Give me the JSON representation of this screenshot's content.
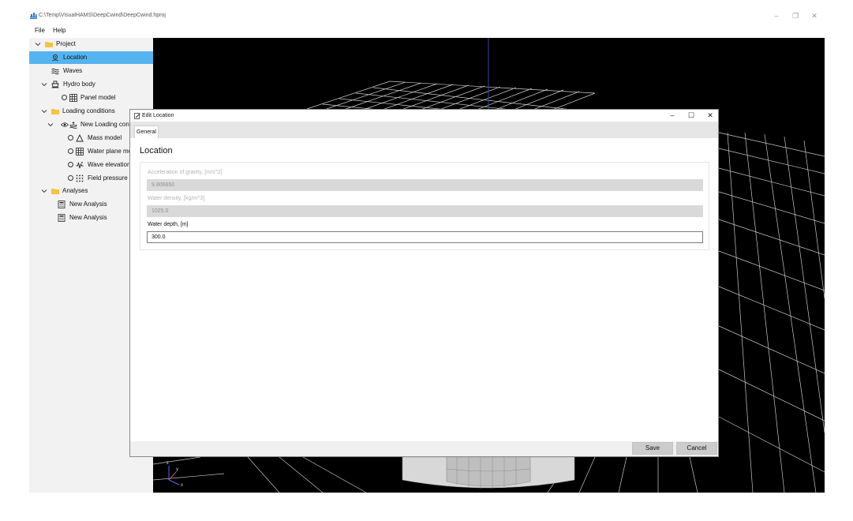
{
  "window": {
    "title": "C:\\Temp\\VisualHAMS\\DeepCwind\\DeepCwind.hproj",
    "minimize": "–",
    "restore": "❐",
    "close": "✕"
  },
  "menu": {
    "file": "File",
    "help": "Help"
  },
  "tree": {
    "project": "Project",
    "location": "Location",
    "waves": "Waves",
    "hydro_body": "Hydro body",
    "panel_model": "Panel model",
    "loading_conditions": "Loading conditions",
    "new_loading_condition": "New Loading condition",
    "mass_model": "Mass model",
    "water_plane_model": "Water plane model",
    "wave_elevation": "Wave elevation points",
    "field_pressure": "Field pressure points",
    "analyses": "Analyses",
    "analysis_1": "New Analysis",
    "analysis_2": "New Analysis"
  },
  "dialog": {
    "title": "Edit Location",
    "minimize": "–",
    "maximize": "☐",
    "close": "✕",
    "tab": "General",
    "section_title": "Location",
    "gravity": {
      "label": "Acceleration of gravity, [m/s^2]",
      "value": "9.806650"
    },
    "density": {
      "label": "Water density, [kg/m^3]",
      "value": "1025.0"
    },
    "depth": {
      "label": "Water depth, [m]",
      "value": "300.0"
    },
    "save": "Save",
    "cancel": "Cancel"
  },
  "colors": {
    "selection": "#55b4ef",
    "folder": "#f5c244",
    "grid_line": "#cfcfcf",
    "viewport_bg": "#000000"
  }
}
